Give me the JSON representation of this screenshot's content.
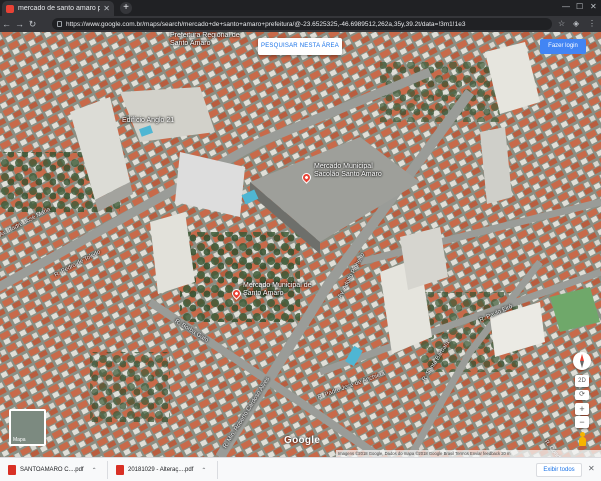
{
  "browser": {
    "tab_title": "mercado de santo amaro prefeitura",
    "new_tab": "+",
    "url": "https://www.google.com.br/maps/search/mercado+de+santo+amaro+prefeitura/@-23.6525325,-46.6989512,262a,35y,39.2t/data=!3m1!1e3"
  },
  "map": {
    "search_this_area": "PESQUISAR NESTA ÁREA",
    "login_button": "Fazer login",
    "places": [
      {
        "name": "Prefeitura Regional de Santo Amaro"
      },
      {
        "name": "Mercado Municipal Sacolão Santo Amaro"
      },
      {
        "name": "Mercado Municipal de Santo Amaro"
      },
      {
        "name": "Edifício Anglo 21"
      }
    ],
    "roads": [
      "R. Pedro de Toledo",
      "Av. Padre José Maria",
      "R. Min. Roberto Cardoso Alves",
      "R. Padre José de Anchieta",
      "R. Santa Bárbara",
      "R. Paulo Eiró",
      "Av. Adolfo Pinheiro",
      "R. Borba Gato",
      "R. Conde de Itu"
    ],
    "minimap_label": "Mapa",
    "brand": "Google",
    "footer": "Imagens ©2018 Google, Dados do mapa ©2018 Google   Brasil   Termos   Enviar feedback   20 m",
    "view_3d": "2D",
    "zoom_in": "+",
    "zoom_out": "−"
  },
  "downloads": {
    "items": [
      {
        "name": "SANTOAMARO C....pdf"
      },
      {
        "name": "20181029 - Alteraç....pdf"
      }
    ],
    "show_all": "Exibir todos"
  },
  "colors": {
    "roof_tile": "#c86a4a",
    "building_white": "#d9d8d2",
    "tree": "#3e5a36",
    "road": "#9a9c98",
    "accent": "#4285f4"
  }
}
